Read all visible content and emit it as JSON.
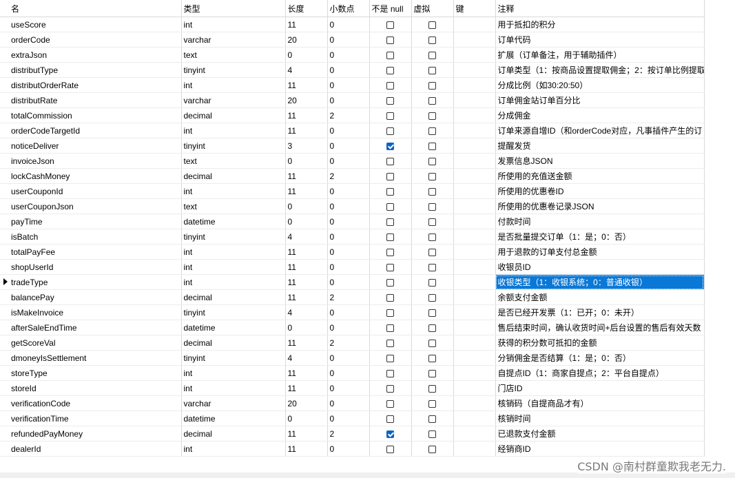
{
  "columns": [
    "名",
    "类型",
    "长度",
    "小数点",
    "不是 null",
    "虚拟",
    "键",
    "注释"
  ],
  "rows": [
    {
      "name": "useScore",
      "type": "int",
      "length": "11",
      "decimal": "0",
      "notnull": false,
      "virtual": false,
      "key": "",
      "comment": "用于抵扣的积分"
    },
    {
      "name": "orderCode",
      "type": "varchar",
      "length": "20",
      "decimal": "0",
      "notnull": false,
      "virtual": false,
      "key": "",
      "comment": "订单代码"
    },
    {
      "name": "extraJson",
      "type": "text",
      "length": "0",
      "decimal": "0",
      "notnull": false,
      "virtual": false,
      "key": "",
      "comment": "扩展（订单备注，用于辅助插件）"
    },
    {
      "name": "distributType",
      "type": "tinyint",
      "length": "4",
      "decimal": "0",
      "notnull": false,
      "virtual": false,
      "key": "",
      "comment": "订单类型（1：按商品设置提取佣金；2：按订单比例提取"
    },
    {
      "name": "distributOrderRate",
      "type": "int",
      "length": "11",
      "decimal": "0",
      "notnull": false,
      "virtual": false,
      "key": "",
      "comment": "分成比例（如30:20:50）"
    },
    {
      "name": "distributRate",
      "type": "varchar",
      "length": "20",
      "decimal": "0",
      "notnull": false,
      "virtual": false,
      "key": "",
      "comment": "订单佣金站订单百分比"
    },
    {
      "name": "totalCommission",
      "type": "decimal",
      "length": "11",
      "decimal": "2",
      "notnull": false,
      "virtual": false,
      "key": "",
      "comment": "分成佣金"
    },
    {
      "name": "orderCodeTargetId",
      "type": "int",
      "length": "11",
      "decimal": "0",
      "notnull": false,
      "virtual": false,
      "key": "",
      "comment": "订单来源自增ID（和orderCode对应，凡事插件产生的订"
    },
    {
      "name": "noticeDeliver",
      "type": "tinyint",
      "length": "3",
      "decimal": "0",
      "notnull": true,
      "virtual": false,
      "key": "",
      "comment": "提醒发货"
    },
    {
      "name": "invoiceJson",
      "type": "text",
      "length": "0",
      "decimal": "0",
      "notnull": false,
      "virtual": false,
      "key": "",
      "comment": "发票信息JSON"
    },
    {
      "name": "lockCashMoney",
      "type": "decimal",
      "length": "11",
      "decimal": "2",
      "notnull": false,
      "virtual": false,
      "key": "",
      "comment": "所使用的充值送金额"
    },
    {
      "name": "userCouponId",
      "type": "int",
      "length": "11",
      "decimal": "0",
      "notnull": false,
      "virtual": false,
      "key": "",
      "comment": "所使用的优惠卷ID"
    },
    {
      "name": "userCouponJson",
      "type": "text",
      "length": "0",
      "decimal": "0",
      "notnull": false,
      "virtual": false,
      "key": "",
      "comment": "所使用的优惠卷记录JSON"
    },
    {
      "name": "payTime",
      "type": "datetime",
      "length": "0",
      "decimal": "0",
      "notnull": false,
      "virtual": false,
      "key": "",
      "comment": "付款时间"
    },
    {
      "name": "isBatch",
      "type": "tinyint",
      "length": "4",
      "decimal": "0",
      "notnull": false,
      "virtual": false,
      "key": "",
      "comment": "是否批量提交订单（1：是；0：否）"
    },
    {
      "name": "totalPayFee",
      "type": "int",
      "length": "11",
      "decimal": "0",
      "notnull": false,
      "virtual": false,
      "key": "",
      "comment": "用于退款的订单支付总金额"
    },
    {
      "name": "shopUserId",
      "type": "int",
      "length": "11",
      "decimal": "0",
      "notnull": false,
      "virtual": false,
      "key": "",
      "comment": "收银员ID"
    },
    {
      "name": "tradeType",
      "type": "int",
      "length": "11",
      "decimal": "0",
      "notnull": false,
      "virtual": false,
      "key": "",
      "comment": "收银类型（1：收银系统；0：普通收银）",
      "current": true
    },
    {
      "name": "balancePay",
      "type": "decimal",
      "length": "11",
      "decimal": "2",
      "notnull": false,
      "virtual": false,
      "key": "",
      "comment": "余额支付金额"
    },
    {
      "name": "isMakeInvoice",
      "type": "tinyint",
      "length": "4",
      "decimal": "0",
      "notnull": false,
      "virtual": false,
      "key": "",
      "comment": "是否已经开发票（1：已开；0：未开）"
    },
    {
      "name": "afterSaleEndTime",
      "type": "datetime",
      "length": "0",
      "decimal": "0",
      "notnull": false,
      "virtual": false,
      "key": "",
      "comment": "售后结束时间，确认收货时间+后台设置的售后有效天数"
    },
    {
      "name": "getScoreVal",
      "type": "decimal",
      "length": "11",
      "decimal": "2",
      "notnull": false,
      "virtual": false,
      "key": "",
      "comment": "获得的积分数可抵扣的金额"
    },
    {
      "name": "dmoneyIsSettlement",
      "type": "tinyint",
      "length": "4",
      "decimal": "0",
      "notnull": false,
      "virtual": false,
      "key": "",
      "comment": "分销佣金是否结算（1：是；0：否）"
    },
    {
      "name": "storeType",
      "type": "int",
      "length": "11",
      "decimal": "0",
      "notnull": false,
      "virtual": false,
      "key": "",
      "comment": "自提点ID（1：商家自提点；2：平台自提点）"
    },
    {
      "name": "storeId",
      "type": "int",
      "length": "11",
      "decimal": "0",
      "notnull": false,
      "virtual": false,
      "key": "",
      "comment": "门店ID"
    },
    {
      "name": "verificationCode",
      "type": "varchar",
      "length": "20",
      "decimal": "0",
      "notnull": false,
      "virtual": false,
      "key": "",
      "comment": "核销码（自提商品才有）"
    },
    {
      "name": "verificationTime",
      "type": "datetime",
      "length": "0",
      "decimal": "0",
      "notnull": false,
      "virtual": false,
      "key": "",
      "comment": "核销时间"
    },
    {
      "name": "refundedPayMoney",
      "type": "decimal",
      "length": "11",
      "decimal": "2",
      "notnull": true,
      "virtual": false,
      "key": "",
      "comment": "已退款支付金额"
    },
    {
      "name": "dealerId",
      "type": "int",
      "length": "11",
      "decimal": "0",
      "notnull": false,
      "virtual": false,
      "key": "",
      "comment": "经销商ID"
    }
  ],
  "watermark": "CSDN @南村群童欺我老无力.",
  "colors": {
    "selection": "#0a78d7",
    "checkbox_on": "#0a64c8"
  }
}
